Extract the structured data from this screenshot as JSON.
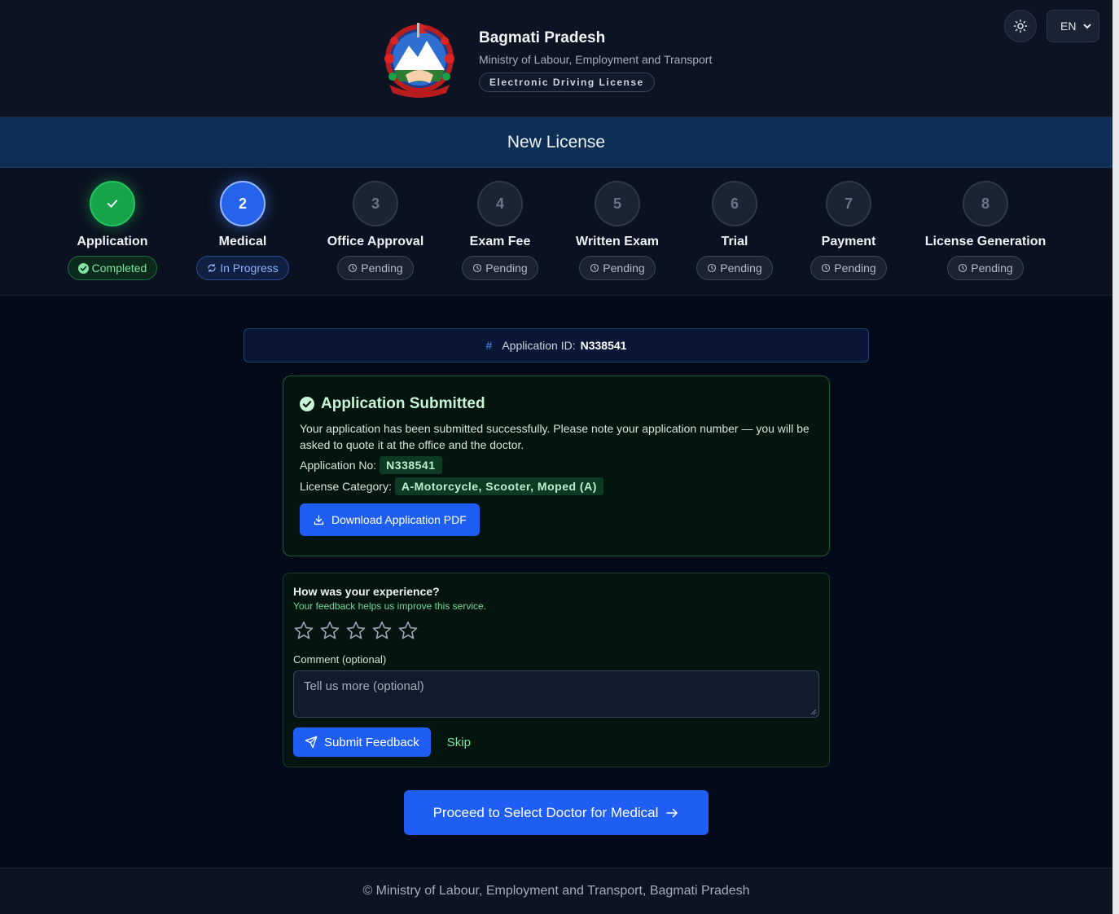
{
  "header": {
    "brand_title": "Bagmati Pradesh",
    "brand_subtitle": "Ministry of Labour, Employment and Transport",
    "brand_badge": "Electronic Driving License",
    "emblem_icon": "nepal-emblem-icon",
    "theme_icon": "sun-icon",
    "language": "EN"
  },
  "page_title": "New License",
  "steps": [
    {
      "number": "",
      "label": "Application",
      "status": "Completed",
      "state": "done"
    },
    {
      "number": "2",
      "label": "Medical",
      "status": "In Progress",
      "state": "active"
    },
    {
      "number": "3",
      "label": "Office Approval",
      "status": "Pending",
      "state": "pending"
    },
    {
      "number": "4",
      "label": "Exam Fee",
      "status": "Pending",
      "state": "pending"
    },
    {
      "number": "5",
      "label": "Written Exam",
      "status": "Pending",
      "state": "pending"
    },
    {
      "number": "6",
      "label": "Trial",
      "status": "Pending",
      "state": "pending"
    },
    {
      "number": "7",
      "label": "Payment",
      "status": "Pending",
      "state": "pending"
    },
    {
      "number": "8",
      "label": "License Generation",
      "status": "Pending",
      "state": "pending"
    }
  ],
  "application_id": {
    "hash": "#",
    "label": "Application ID:",
    "value": "N338541"
  },
  "submitted": {
    "title": "Application Submitted",
    "message": "Your application has been submitted successfully. Please note your application number — you will be asked to quote it at the office and the doctor.",
    "app_no_label": "Application No:",
    "app_no_value": "N338541",
    "category_label": "License Category:",
    "category_value": "A-Motorcycle, Scooter, Moped (A)",
    "download_label": "Download Application PDF"
  },
  "feedback": {
    "title": "How was your experience?",
    "subtitle": "Your feedback helps us improve this service.",
    "rating": 0,
    "rating_max": 5,
    "comment_label": "Comment (optional)",
    "comment_placeholder": "Tell us more (optional)",
    "submit_label": "Submit Feedback",
    "skip_label": "Skip"
  },
  "proceed_label": "Proceed to Select Doctor for Medical",
  "footer_text": "© Ministry of Labour, Employment and Transport, Bagmati Pradesh",
  "colors": {
    "accent": "#1f5ef5",
    "success": "#22c55e",
    "background": "#030b1a"
  }
}
